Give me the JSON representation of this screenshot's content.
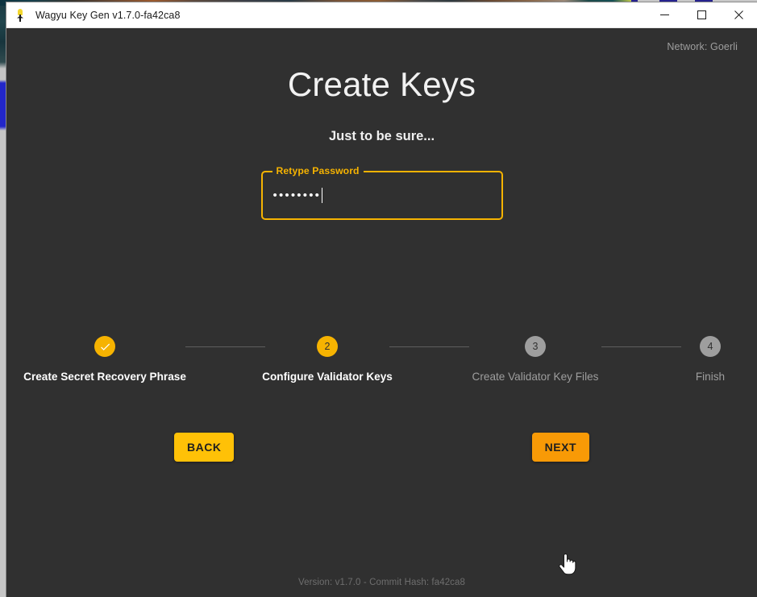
{
  "window": {
    "title": "Wagyu Key Gen v1.7.0-fa42ca8",
    "app_icon": "wagyu-logo-icon",
    "controls": {
      "minimize": "minimize-icon",
      "maximize": "maximize-icon",
      "close": "close-icon"
    }
  },
  "app": {
    "network_label": "Network: Goerli",
    "title": "Create Keys",
    "subtitle": "Just to be sure...",
    "field": {
      "label": "Retype Password",
      "value": "••••••••",
      "type": "password",
      "char_count": 8,
      "focused": true
    },
    "stepper": {
      "steps": [
        {
          "number": "1",
          "marker": "check-icon",
          "label": "Create Secret Recovery Phrase",
          "state": "done"
        },
        {
          "number": "2",
          "marker": "2",
          "label": "Configure Validator Keys",
          "state": "active"
        },
        {
          "number": "3",
          "marker": "3",
          "label": "Create Validator Key Files",
          "state": "pending"
        },
        {
          "number": "4",
          "marker": "4",
          "label": "Finish",
          "state": "pending"
        }
      ]
    },
    "buttons": {
      "back": "BACK",
      "next": "NEXT",
      "next_hovered": true
    },
    "footer": "Version: v1.7.0 - Commit Hash: fa42ca8"
  },
  "colors": {
    "accent": "#f6b301",
    "accent_button": "#ffc107",
    "accent_button_hover": "#f89a06",
    "background": "#303030",
    "text_primary": "#ffffff",
    "text_muted": "#9e9e9e",
    "text_footer": "#6e6e6e",
    "titlebar_background": "#ffffff"
  }
}
